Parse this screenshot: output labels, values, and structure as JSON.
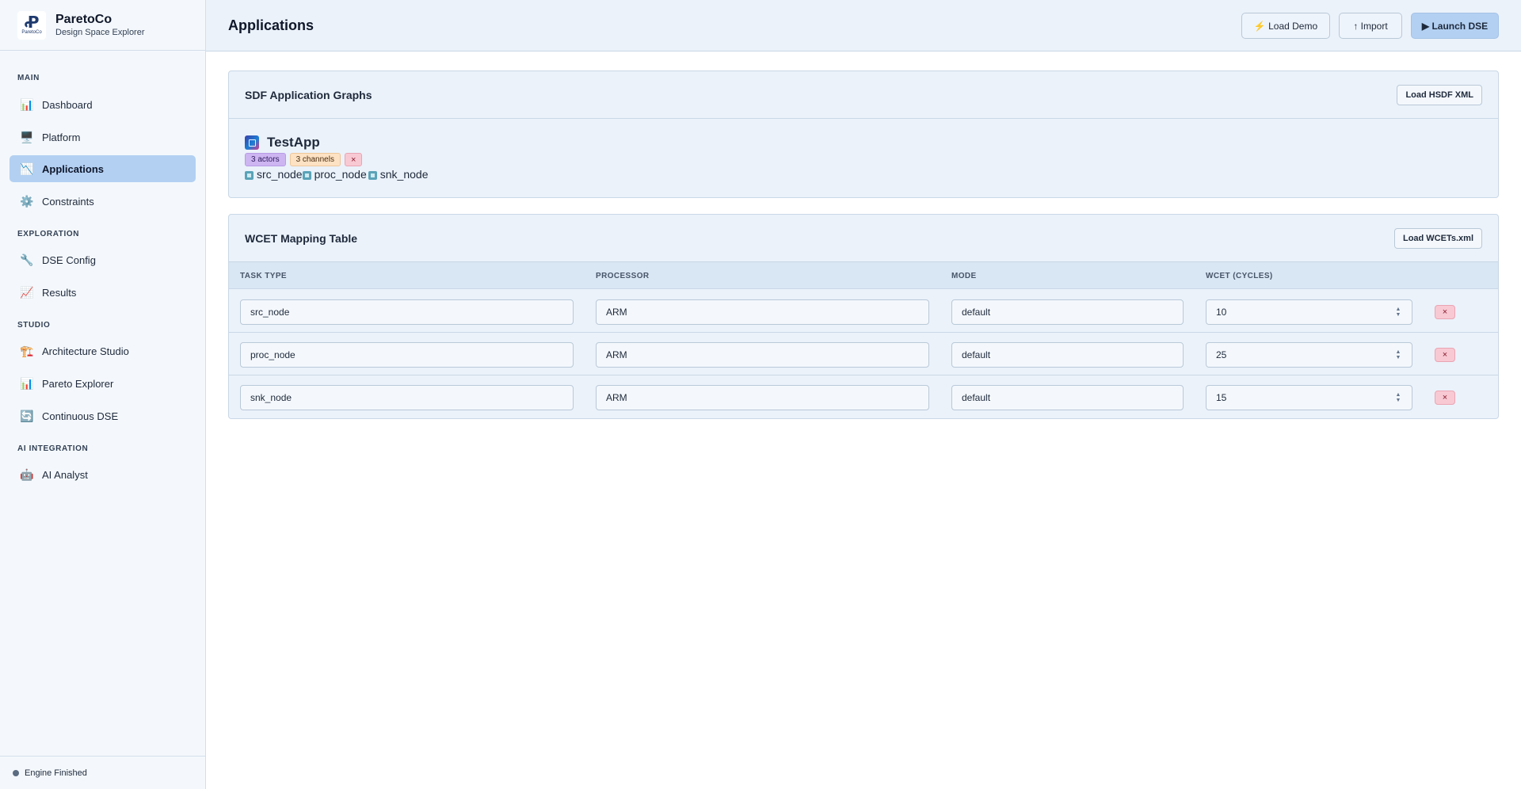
{
  "brand": {
    "name": "ParetoCo",
    "subtitle": "Design Space Explorer",
    "logo_text": "ParetoCo"
  },
  "sidebar": {
    "sections": [
      {
        "label": "MAIN",
        "items": [
          {
            "label": "Dashboard",
            "icon": "📊"
          },
          {
            "label": "Platform",
            "icon": "🖥️"
          },
          {
            "label": "Applications",
            "icon": "📉",
            "active": true
          },
          {
            "label": "Constraints",
            "icon": "⚙️"
          }
        ]
      },
      {
        "label": "EXPLORATION",
        "items": [
          {
            "label": "DSE Config",
            "icon": "🔧"
          },
          {
            "label": "Results",
            "icon": "📈"
          }
        ]
      },
      {
        "label": "STUDIO",
        "items": [
          {
            "label": "Architecture Studio",
            "icon": "🏗️"
          },
          {
            "label": "Pareto Explorer",
            "icon": "📊"
          },
          {
            "label": "Continuous DSE",
            "icon": "🔄"
          }
        ]
      },
      {
        "label": "AI INTEGRATION",
        "items": [
          {
            "label": "AI Analyst",
            "icon": "🤖"
          }
        ]
      }
    ],
    "status": "Engine Finished"
  },
  "header": {
    "title": "Applications",
    "load_demo": "⚡ Load Demo",
    "import": "↑ Import",
    "launch": "▶ Launch DSE"
  },
  "sdf": {
    "title": "SDF Application Graphs",
    "load_button": "Load HSDF XML",
    "app": {
      "name": "TestApp",
      "actors_tag": "3 actors",
      "channels_tag": "3 channels",
      "remove": "×",
      "actors": [
        "src_node",
        "proc_node",
        "snk_node"
      ]
    }
  },
  "wcet": {
    "title": "WCET Mapping Table",
    "load_button": "Load WCETs.xml",
    "columns": [
      "TASK TYPE",
      "PROCESSOR",
      "MODE",
      "WCET (CYCLES)"
    ],
    "rows": [
      {
        "task": "src_node",
        "processor": "ARM",
        "mode": "default",
        "wcet": "10",
        "remove": "×"
      },
      {
        "task": "proc_node",
        "processor": "ARM",
        "mode": "default",
        "wcet": "25",
        "remove": "×"
      },
      {
        "task": "snk_node",
        "processor": "ARM",
        "mode": "default",
        "wcet": "15",
        "remove": "×"
      }
    ]
  }
}
